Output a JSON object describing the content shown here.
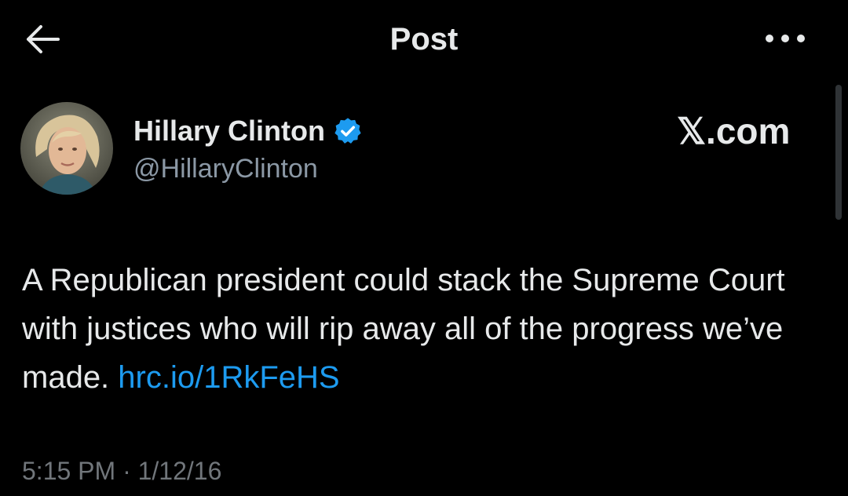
{
  "header": {
    "title": "Post",
    "back_icon": "arrow-left-icon",
    "more_icon": "more-horizontal-icon"
  },
  "author": {
    "display_name": "Hillary Clinton",
    "handle": "@HillaryClinton",
    "verified": true,
    "verified_icon": "verified-badge-icon",
    "verified_color": "#1d9bf0"
  },
  "watermark": "𝕏.com",
  "post": {
    "text": "A Republican president could stack the Supreme Court with justices who will rip away all of the progress we’ve made.",
    "link": "hrc.io/1RkFeHS",
    "time": "5:15 PM",
    "separator": "·",
    "date": "1/12/16"
  },
  "colors": {
    "background": "#000000",
    "text": "#e7e9ea",
    "secondary": "#71767b",
    "link": "#1d9bf0"
  }
}
